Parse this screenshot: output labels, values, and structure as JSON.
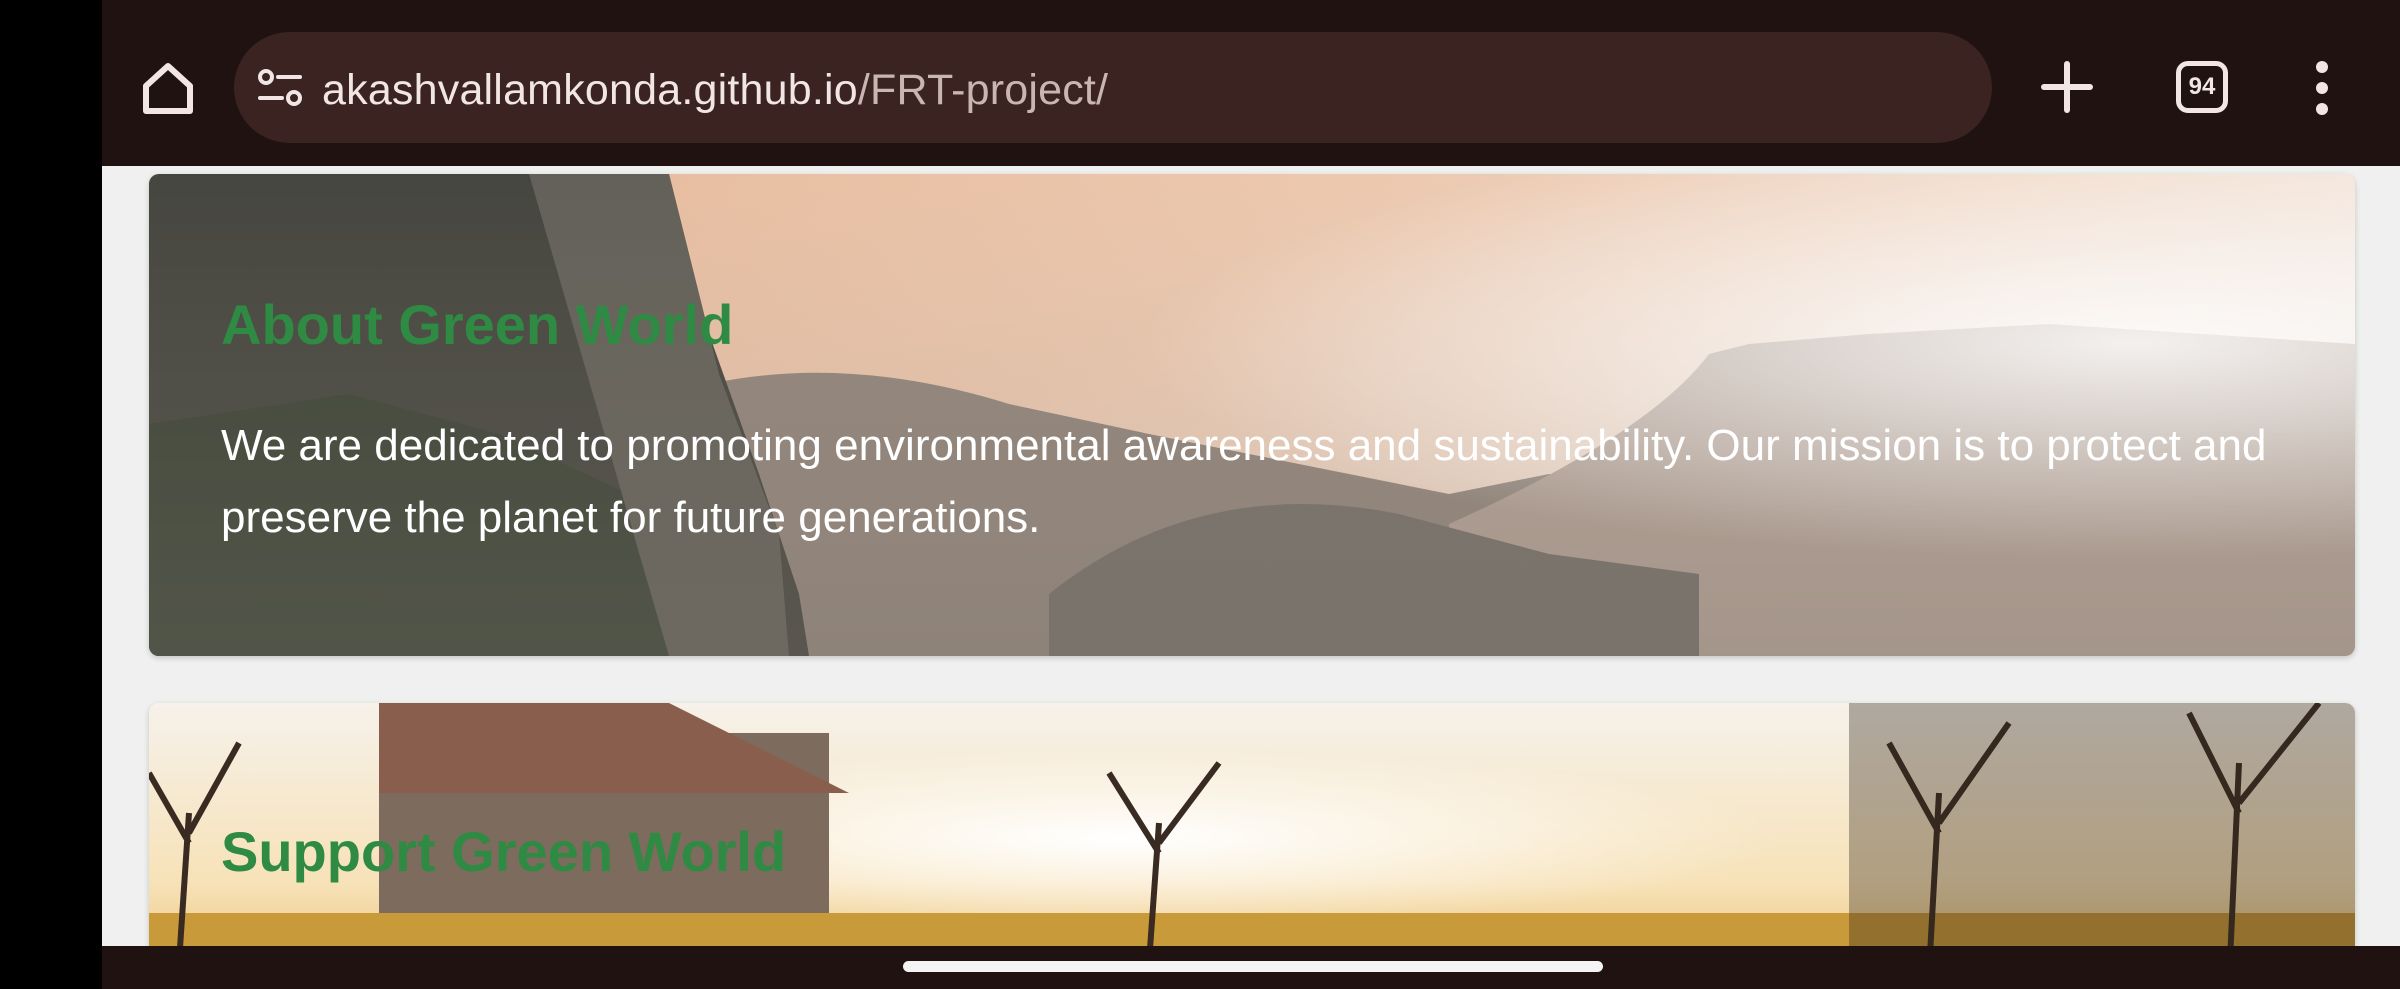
{
  "browser": {
    "url_host": "akashvallamkonda.github.io",
    "url_path": "/FRT-project/",
    "tab_count": "94",
    "icons": {
      "home": "home-icon",
      "site_settings": "tune-icon",
      "new_tab": "plus-icon",
      "tab_switcher": "tab-switcher-icon",
      "menu": "more-vert-icon"
    },
    "colors": {
      "toolbar": "#1f1211",
      "omnibox": "#3a2320",
      "icon": "#f1e6e3"
    }
  },
  "page": {
    "background": "#eff0ef",
    "accent": "#2f8a43",
    "about": {
      "title": "About Green World",
      "text": "We are dedicated to promoting environmental awareness and sustainability. Our mission is to protect and preserve the planet for future generations."
    },
    "support": {
      "title": "Support Green World"
    }
  }
}
